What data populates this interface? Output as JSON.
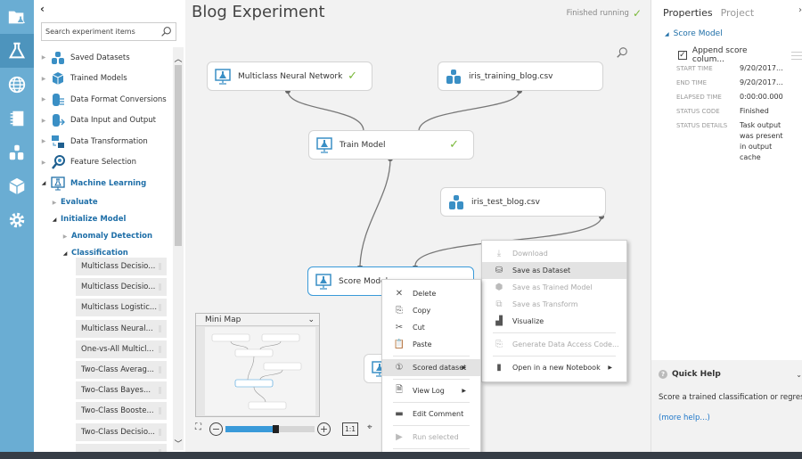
{
  "rail": {
    "items": [
      {
        "icon": "projects-icon",
        "active": false
      },
      {
        "icon": "experiments-icon",
        "active": true
      },
      {
        "icon": "web-services-icon",
        "active": false
      },
      {
        "icon": "notebooks-icon",
        "active": false
      },
      {
        "icon": "datasets-icon",
        "active": false
      },
      {
        "icon": "trained-models-icon",
        "active": false
      },
      {
        "icon": "settings-icon",
        "active": false
      }
    ]
  },
  "palette": {
    "collapse_label": "‹",
    "search_placeholder": "Search experiment items",
    "tree": [
      {
        "label": "Saved Datasets",
        "icon": "datasets-icon",
        "expanded": false
      },
      {
        "label": "Trained Models",
        "icon": "cube-icon",
        "expanded": false
      },
      {
        "label": "Data Format Conversions",
        "icon": "format-conversion-icon",
        "expanded": false
      },
      {
        "label": "Data Input and Output",
        "icon": "data-io-icon",
        "expanded": false
      },
      {
        "label": "Data Transformation",
        "icon": "transformation-icon",
        "expanded": false
      },
      {
        "label": "Feature Selection",
        "icon": "feature-selection-icon",
        "expanded": false
      },
      {
        "label": "Machine Learning",
        "icon": "machine-learning-icon",
        "expanded": true
      }
    ],
    "ml_children": [
      {
        "label": "Evaluate",
        "expanded": false
      },
      {
        "label": "Initialize Model",
        "expanded": true
      }
    ],
    "init_children": [
      {
        "label": "Anomaly Detection",
        "expanded": false
      },
      {
        "label": "Classification",
        "expanded": true
      }
    ],
    "modules": [
      "Multiclass Decisio...",
      "Multiclass Decisio...",
      "Multiclass Logistic...",
      "Multiclass Neural...",
      "One-vs-All Multicl...",
      "Two-Class Averag...",
      "Two-Class Bayes...",
      "Two-Class Booste...",
      "Two-Class Decisio..."
    ]
  },
  "canvas": {
    "title": "Blog Experiment",
    "run_status": "Finished running",
    "nodes": [
      {
        "id": "mnn",
        "label": "Multiclass Neural Network",
        "icon": "model-icon",
        "done": true,
        "selected": false
      },
      {
        "id": "train_csv",
        "label": "iris_training_blog.csv",
        "icon": "dataset-icon",
        "done": false,
        "selected": false
      },
      {
        "id": "train",
        "label": "Train Model",
        "icon": "model-icon",
        "done": true,
        "selected": false
      },
      {
        "id": "test_csv",
        "label": "iris_test_blog.csv",
        "icon": "dataset-icon",
        "done": false,
        "selected": false
      },
      {
        "id": "score",
        "label": "Score Model",
        "icon": "model-icon",
        "done": true,
        "selected": true
      }
    ],
    "minimap_title": "Mini Map",
    "zoom_level": 0.6,
    "zoom_reset_label": "1:1"
  },
  "context_menu": {
    "items": [
      {
        "label": "Delete",
        "icon": "✕",
        "disabled": false
      },
      {
        "label": "Copy",
        "icon": "⎘",
        "disabled": false
      },
      {
        "label": "Cut",
        "icon": "✂",
        "disabled": false
      },
      {
        "label": "Paste",
        "icon": "📋",
        "disabled": false
      },
      {
        "label": "Scored dataset",
        "icon": "①",
        "disabled": false,
        "submenu": true,
        "hover": true
      },
      {
        "label": "View Log",
        "icon": "🗎",
        "disabled": false,
        "submenu": true
      },
      {
        "label": "Edit Comment",
        "icon": "▬",
        "disabled": false
      },
      {
        "label": "Run selected",
        "icon": "▶",
        "disabled": true
      }
    ]
  },
  "submenu": {
    "items": [
      {
        "label": "Download",
        "icon": "⤓",
        "disabled": true
      },
      {
        "label": "Save as Dataset",
        "icon": "⛁",
        "disabled": false,
        "hover": true
      },
      {
        "label": "Save as Trained Model",
        "icon": "⬢",
        "disabled": true
      },
      {
        "label": "Save as Transform",
        "icon": "⧉",
        "disabled": true
      },
      {
        "label": "Visualize",
        "icon": "▟",
        "disabled": false
      },
      {
        "label": "Generate Data Access Code...",
        "icon": "⎘",
        "disabled": true
      },
      {
        "label": "Open in a new Notebook",
        "icon": "▮",
        "disabled": false,
        "submenu": true
      }
    ]
  },
  "properties": {
    "tabs": [
      "Properties",
      "Project"
    ],
    "section": "Score Model",
    "checkbox_label": "Append score colum...",
    "checkbox_checked": true,
    "rows": [
      {
        "key": "START TIME",
        "value": "9/20/2017..."
      },
      {
        "key": "END TIME",
        "value": "9/20/2017..."
      },
      {
        "key": "ELAPSED TIME",
        "value": "0:00:00.000"
      },
      {
        "key": "STATUS CODE",
        "value": "Finished"
      },
      {
        "key": "STATUS DETAILS",
        "value": "Task output was present in output cache"
      }
    ]
  },
  "quick_help": {
    "title": "Quick Help",
    "text": "Score a trained classification or regression model",
    "link": "(more help...)"
  }
}
